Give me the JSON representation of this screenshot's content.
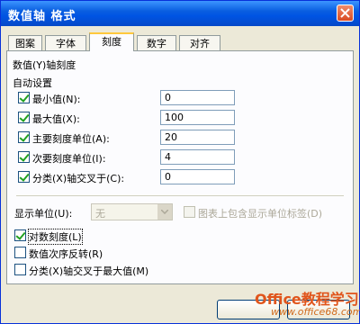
{
  "window": {
    "title": "数值轴 格式"
  },
  "tabs": [
    {
      "label": "图案"
    },
    {
      "label": "字体"
    },
    {
      "label": "刻度"
    },
    {
      "label": "数字"
    },
    {
      "label": "对齐"
    }
  ],
  "active_tab": "刻度",
  "scale": {
    "group_title": "数值(Y)轴刻度",
    "auto_label": "自动设置",
    "rows": [
      {
        "label": "最小值(N):",
        "checked": true,
        "value": "0"
      },
      {
        "label": "最大值(X):",
        "checked": true,
        "value": "100"
      },
      {
        "label": "主要刻度单位(A):",
        "checked": true,
        "value": "20"
      },
      {
        "label": "次要刻度单位(I):",
        "checked": true,
        "value": "4"
      },
      {
        "label": "分类(X)轴交叉于(C):",
        "checked": true,
        "value": "0"
      }
    ],
    "display_unit_label": "显示单位(U):",
    "display_unit_value": "无",
    "show_unit_label": "图表上包含显示单位标签(D)",
    "options": [
      {
        "label": "对数刻度(L)",
        "checked": true
      },
      {
        "label": "数值次序反转(R)",
        "checked": false
      },
      {
        "label": "分类(X)轴交叉于最大值(M)",
        "checked": false
      }
    ]
  },
  "watermark": {
    "brand": "Office教程学习网",
    "url": "www.office68.com"
  },
  "colors": {
    "title_bar": "#0054e3",
    "dialog_bg": "#ece9d8",
    "tab_highlight": "#ffc83c",
    "checkmark": "#21a121"
  }
}
